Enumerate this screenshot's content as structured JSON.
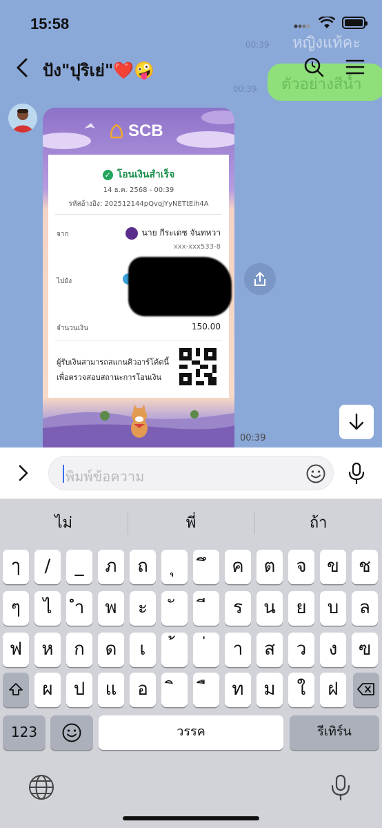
{
  "status_bar": {
    "time": "15:58"
  },
  "background_chat": {
    "ghost_text_1": "หญิงแท้คะ",
    "ghost_text_2": "ตัวอย่างสีน้ำ",
    "ghost_time_1": "00:39",
    "ghost_time_2": "00:39"
  },
  "header": {
    "title": "ปัง\"ปุริเย่\"❤️🤪"
  },
  "receipt": {
    "brand": "SCB",
    "status": "โอนเงินสำเร็จ",
    "date": "14 ธ.ค. 2568 - 00:39",
    "reference": "รหัสอ้างอิง: 202512144pQvqjYyNETtEih4A",
    "from_label": "จาก",
    "from_name": "นาย กีระเดช จันทหวา",
    "from_account": "xxx-xxx533-8",
    "to_label": "ไปยัง",
    "amount_label": "จำนวนเงิน",
    "amount": "150.00",
    "note": "ผู้รับเงินสามารถสแกนคิวอาร์โค้ดนี้เพื่อตรวจสอบสถานะการโอนเงิน"
  },
  "message": {
    "time": "00:39"
  },
  "input": {
    "placeholder": "พิมพ์ข้อความ"
  },
  "keyboard": {
    "suggestions": [
      "ไม่",
      "พี่",
      "ถ้า"
    ],
    "row1": [
      "ๅ",
      "/",
      "_",
      "ภ",
      "ถ",
      "ุ",
      "ึ",
      "ค",
      "ต",
      "จ",
      "ข",
      "ช"
    ],
    "row2": [
      "ๆ",
      "ไ",
      "ำ",
      "พ",
      "ะ",
      "ั",
      "ี",
      "ร",
      "น",
      "ย",
      "บ",
      "ล"
    ],
    "row3": [
      "ฟ",
      "ห",
      "ก",
      "ด",
      "เ",
      "้",
      "่",
      "า",
      "ส",
      "ว",
      "ง",
      "ฃ"
    ],
    "row4": [
      "ผ",
      "ป",
      "แ",
      "อ",
      "ิ",
      "ื",
      "ท",
      "ม",
      "ใ",
      "ฝ"
    ],
    "numbers_key": "123",
    "space_key": "วรรค",
    "return_key": "รีเทิร์น"
  }
}
